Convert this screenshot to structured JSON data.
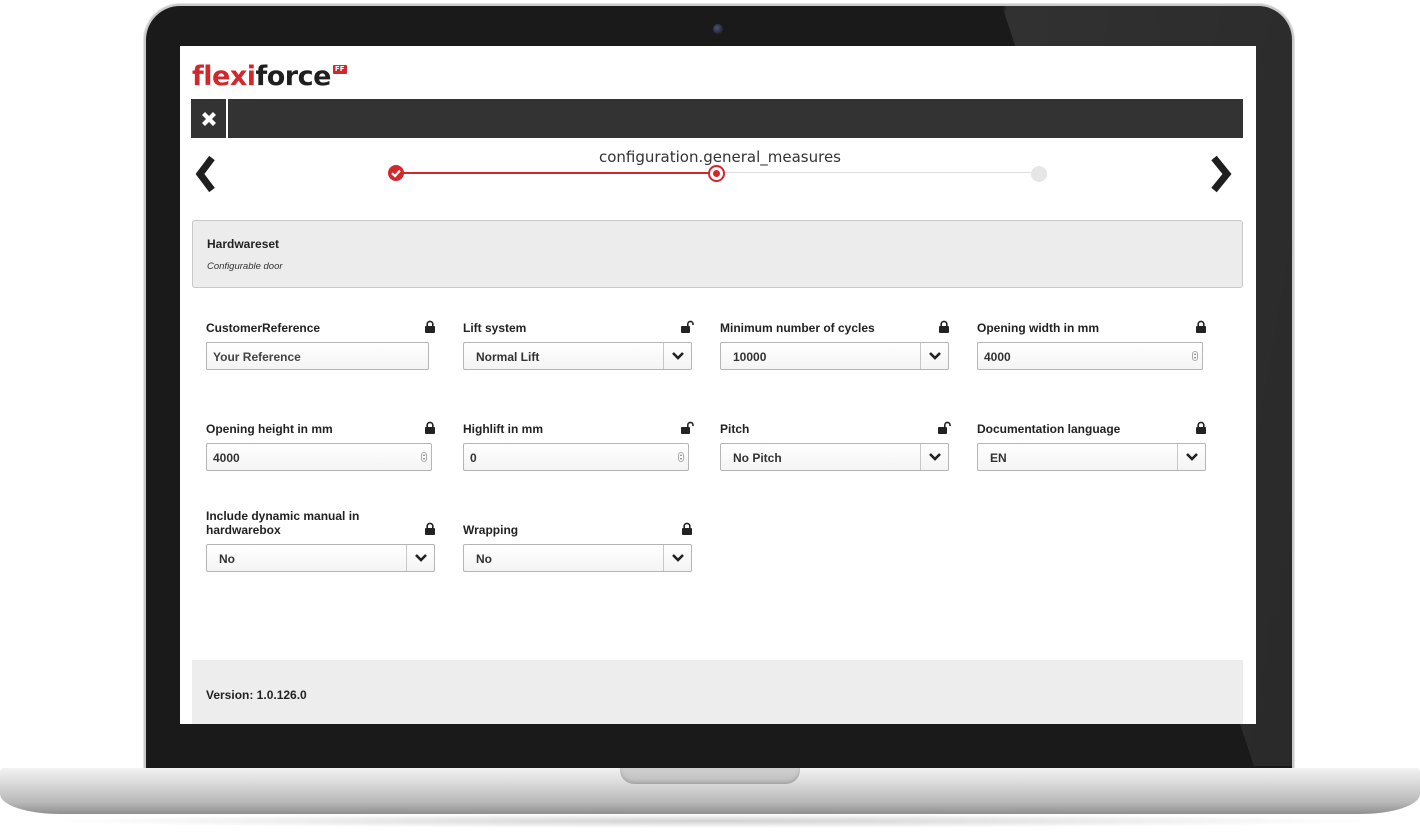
{
  "logo": {
    "part1": "flexi",
    "part2": "force",
    "badge": "FF"
  },
  "wizard": {
    "step_title": "configuration.general_measures",
    "steps": [
      "completed",
      "current",
      "pending"
    ],
    "accent": "#d1282d"
  },
  "info": {
    "title": "Hardwareset",
    "subtitle": "Configurable door"
  },
  "fields": {
    "customer_reference": {
      "label": "CustomerReference",
      "value": "Your Reference",
      "lock": "locked"
    },
    "lift_system": {
      "label": "Lift system",
      "value": "Normal Lift",
      "lock": "unlocked"
    },
    "min_cycles": {
      "label": "Minimum number of cycles",
      "value": "10000",
      "lock": "locked"
    },
    "opening_width": {
      "label": "Opening width in mm",
      "value": "4000",
      "lock": "locked"
    },
    "opening_height": {
      "label": "Opening height in mm",
      "value": "4000",
      "lock": "locked"
    },
    "highlift": {
      "label": "Highlift in mm",
      "value": "0",
      "lock": "unlocked"
    },
    "pitch": {
      "label": "Pitch",
      "value": "No Pitch",
      "lock": "unlocked"
    },
    "doc_language": {
      "label": "Documentation language",
      "value": "EN",
      "lock": "locked"
    },
    "dynamic_manual": {
      "label": "Include dynamic manual in hardwarebox",
      "value": "No",
      "lock": "locked"
    },
    "wrapping": {
      "label": "Wrapping",
      "value": "No",
      "lock": "locked"
    }
  },
  "footer": {
    "version": "Version: 1.0.126.0"
  },
  "icons": {
    "close": "close-icon",
    "prev": "chevron-left-icon",
    "next": "chevron-right-icon",
    "dropdown": "chevron-down-icon",
    "lock": "lock-icon",
    "unlock": "unlock-icon"
  }
}
